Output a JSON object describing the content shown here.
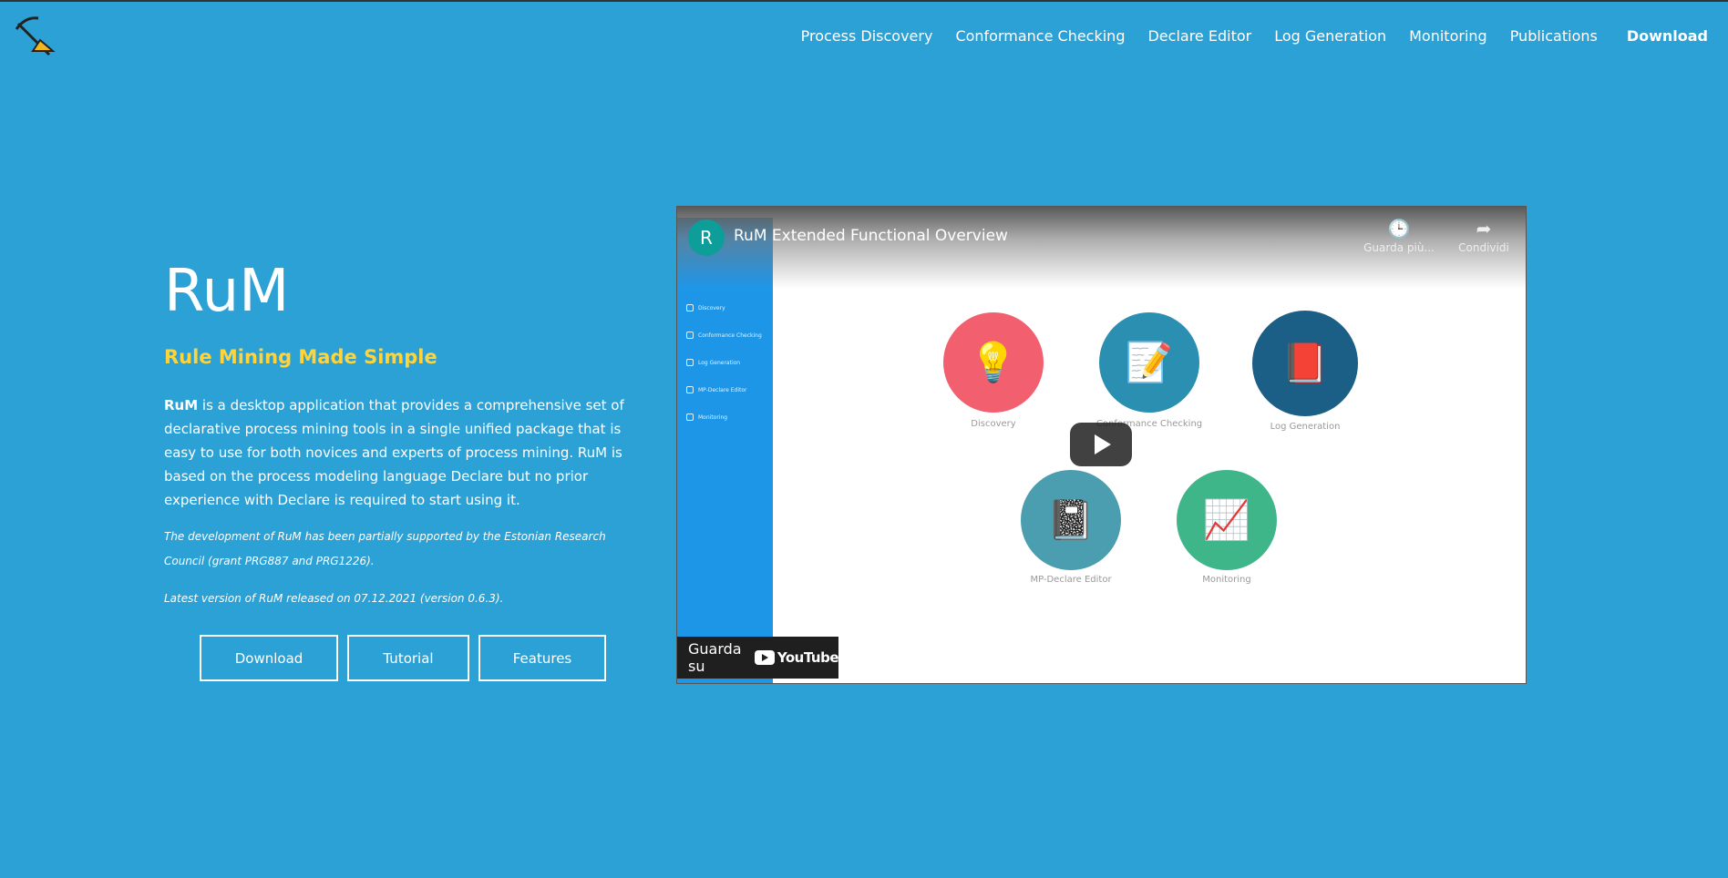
{
  "nav": {
    "items": [
      "Process Discovery",
      "Conformance Checking",
      "Declare Editor",
      "Log Generation",
      "Monitoring",
      "Publications"
    ],
    "download": "Download"
  },
  "hero": {
    "title": "RuM",
    "subtitle": "Rule Mining Made Simple",
    "desc_bold": "RuM",
    "desc_rest": " is a desktop application that provides a comprehensive set of declarative process mining tools in a single unified package that is easy to use for both novices and experts of process mining. RuM is based on the process modeling language Declare but no prior experience with Declare is required to start using it.",
    "note1": "The development of RuM has been partially supported by the Estonian Research Council (grant PRG887 and PRG1226).",
    "note2": "Latest version of RuM released on 07.12.2021 (version 0.6.3).",
    "buttons": [
      "Download",
      "Tutorial",
      "Features"
    ]
  },
  "video": {
    "avatar": "R",
    "title": "RuM Extended Functional Overview",
    "watch_later": "Guarda più...",
    "share": "Condividi",
    "sidebar": [
      "Discovery",
      "Conformance Checking",
      "Log Generation",
      "MP-Declare Editor",
      "Monitoring"
    ],
    "tiles": [
      "Discovery",
      "Conformance Checking",
      "Log Generation",
      "MP-Declare Editor",
      "Monitoring"
    ],
    "watch_on": "Guarda su",
    "youtube": "YouTube"
  }
}
